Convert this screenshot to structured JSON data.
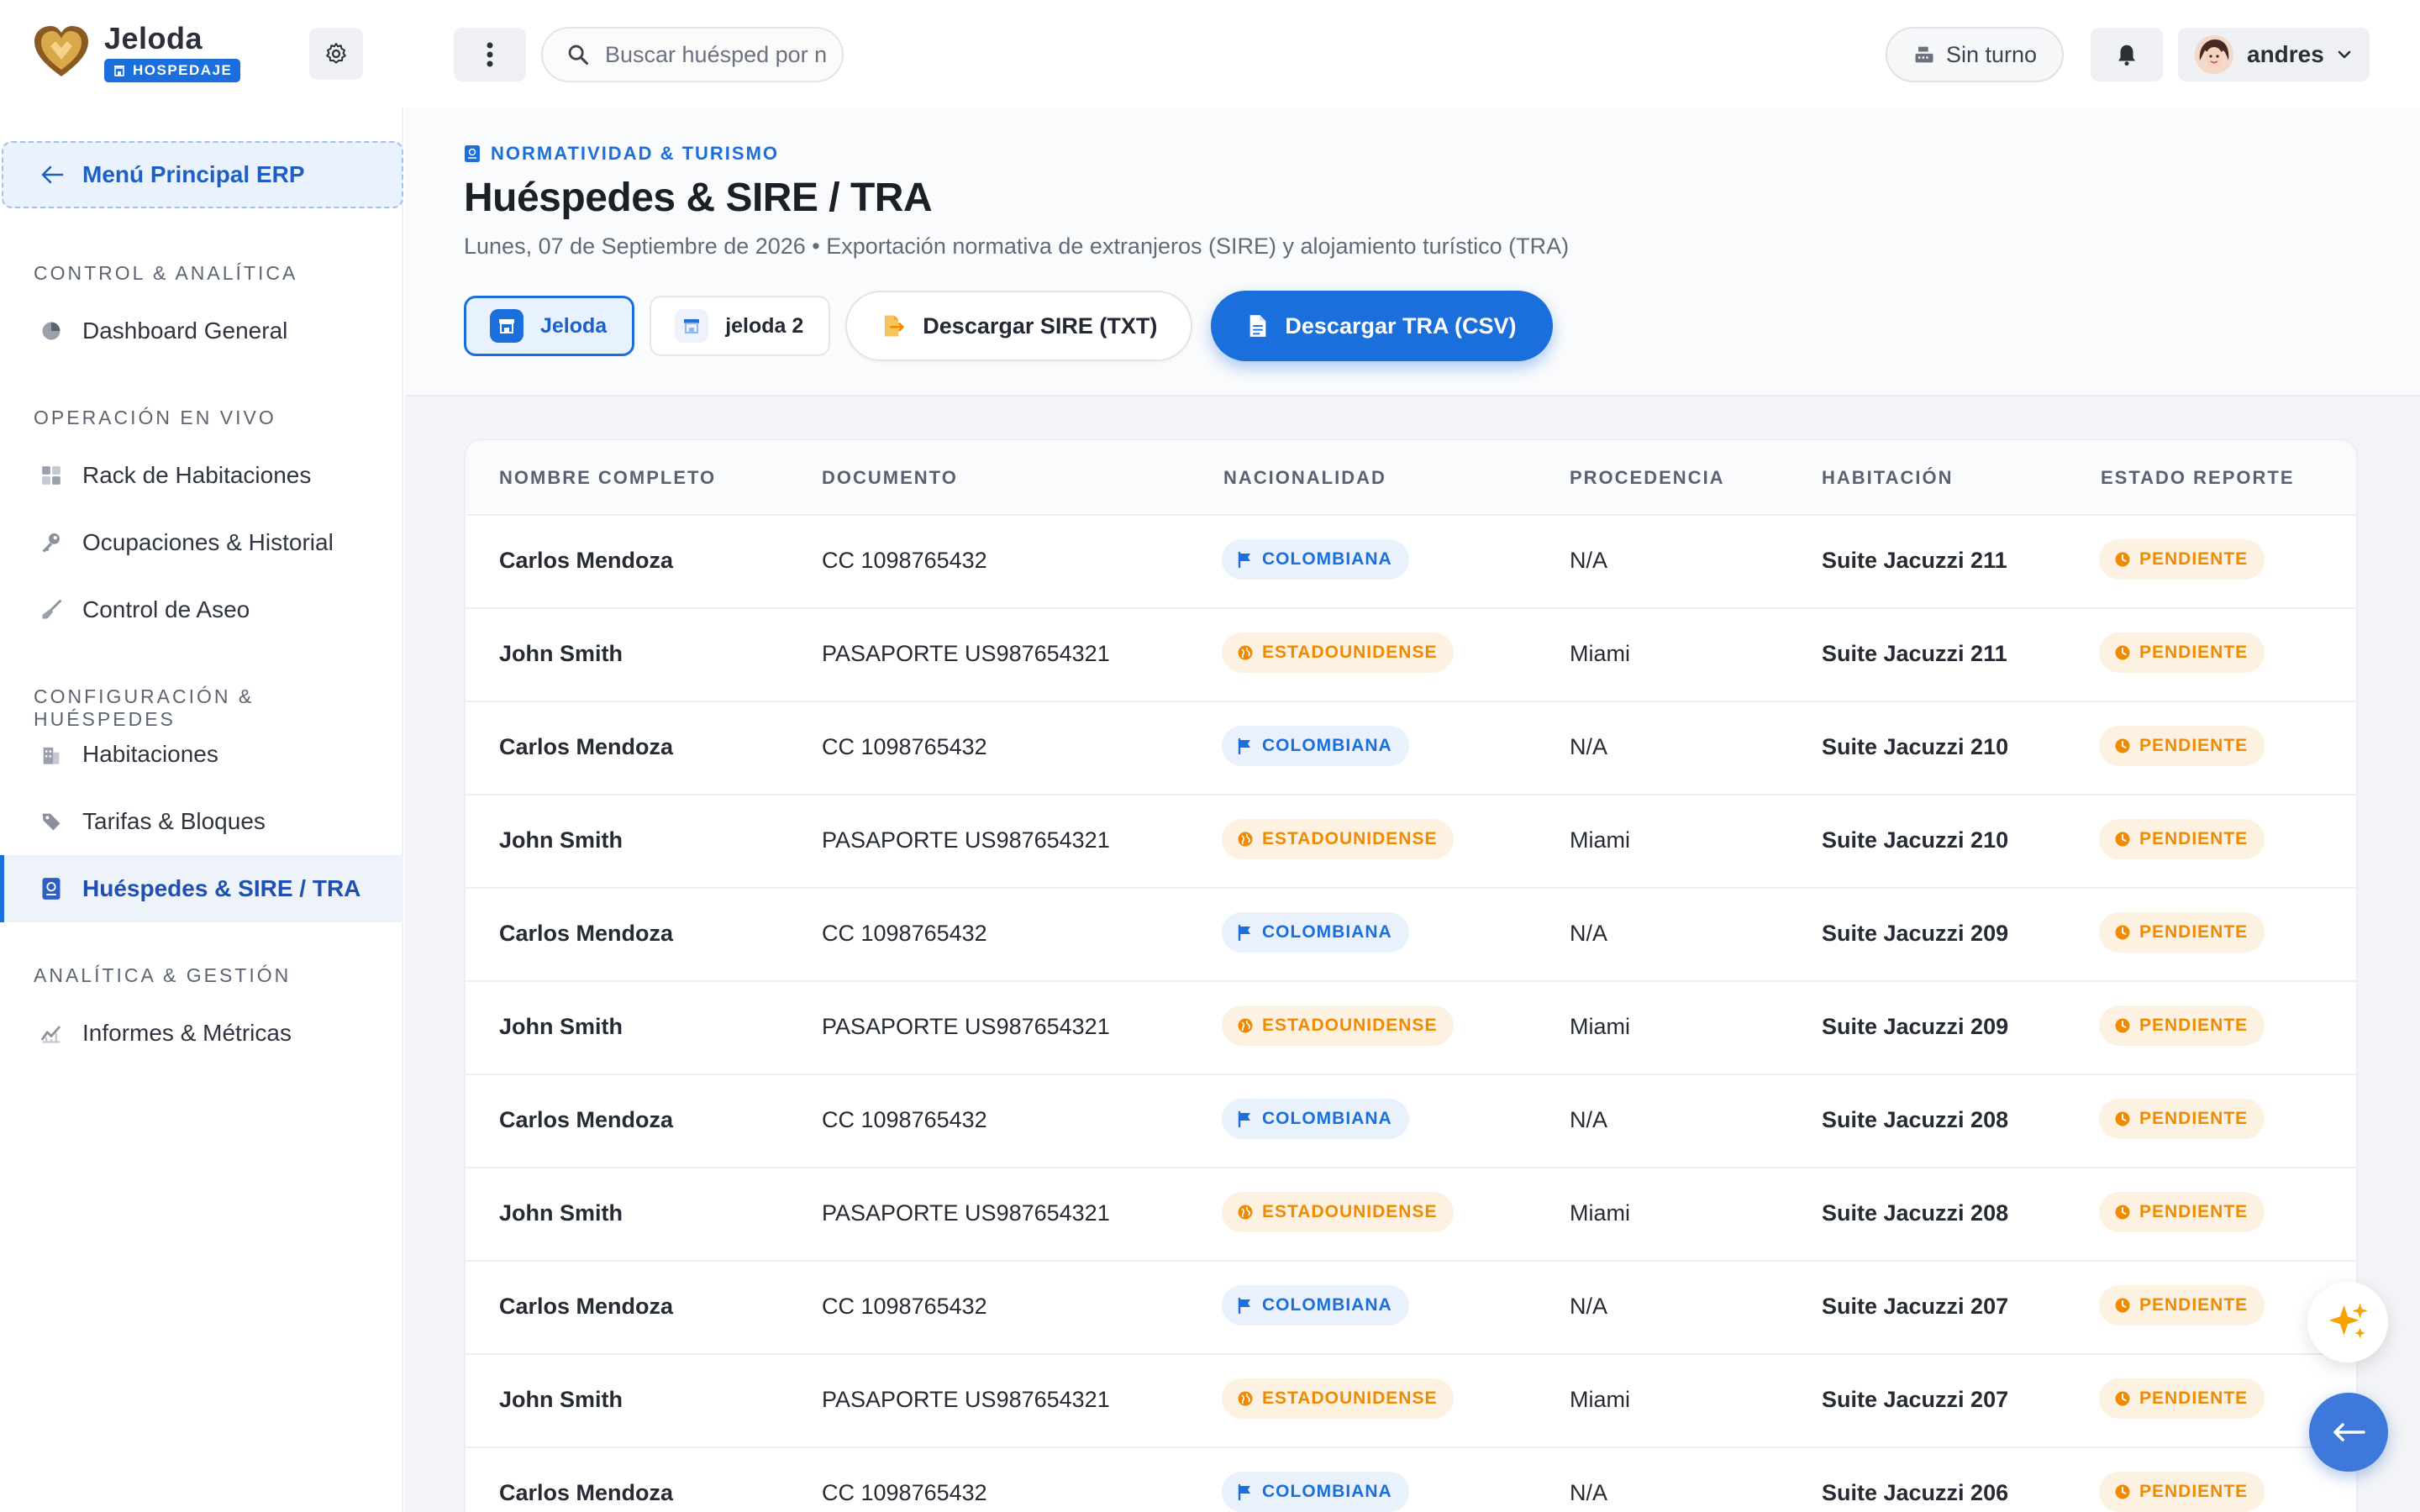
{
  "brand": {
    "name": "Jeloda",
    "badge": "HOSPEDAJE"
  },
  "topbar": {
    "search_placeholder": "Buscar huésped por n",
    "shift_label": "Sin turno",
    "user_name": "andres"
  },
  "sidebar": {
    "back_label": "Menú Principal ERP",
    "sections": [
      {
        "title": "CONTROL & ANALÍTICA",
        "items": [
          {
            "label": "Dashboard General",
            "icon": "pie-chart-icon"
          }
        ]
      },
      {
        "title": "OPERACIÓN EN VIVO",
        "items": [
          {
            "label": "Rack de Habitaciones",
            "icon": "grid-icon"
          },
          {
            "label": "Ocupaciones & Historial",
            "icon": "key-icon"
          },
          {
            "label": "Control de Aseo",
            "icon": "broom-icon"
          }
        ]
      },
      {
        "title": "CONFIGURACIÓN & HUÉSPEDES",
        "items": [
          {
            "label": "Habitaciones",
            "icon": "building-icon"
          },
          {
            "label": "Tarifas & Bloques",
            "icon": "tag-icon"
          },
          {
            "label": "Huéspedes & SIRE / TRA",
            "icon": "passport-icon",
            "active": true
          }
        ]
      },
      {
        "title": "ANALÍTICA & GESTIÓN",
        "items": [
          {
            "label": "Informes & Métricas",
            "icon": "line-chart-icon"
          }
        ]
      }
    ]
  },
  "header": {
    "overline": "NORMATIVIDAD & TURISMO",
    "title": "Huéspedes & SIRE / TRA",
    "subtitle": "Lunes, 07 de Septiembre de 2026 • Exportación normativa de extranjeros (SIRE) y alojamiento turístico (TRA)",
    "hotels": [
      {
        "label": "Jeloda",
        "selected": true
      },
      {
        "label": "jeloda 2",
        "selected": false
      }
    ],
    "download_sire": "Descargar SIRE (TXT)",
    "download_tra": "Descargar TRA (CSV)"
  },
  "table": {
    "columns": [
      "NOMBRE COMPLETO",
      "DOCUMENTO",
      "NACIONALIDAD",
      "PROCEDENCIA",
      "HABITACIÓN",
      "ESTADO REPORTE"
    ],
    "rows": [
      {
        "name": "Carlos Mendoza",
        "document": "CC 1098765432",
        "nationality": "COLOMBIANA",
        "origin": "N/A",
        "room": "Suite Jacuzzi 211",
        "status": "PENDIENTE"
      },
      {
        "name": "John Smith",
        "document": "PASAPORTE US987654321",
        "nationality": "ESTADOUNIDENSE",
        "origin": "Miami",
        "room": "Suite Jacuzzi 211",
        "status": "PENDIENTE"
      },
      {
        "name": "Carlos Mendoza",
        "document": "CC 1098765432",
        "nationality": "COLOMBIANA",
        "origin": "N/A",
        "room": "Suite Jacuzzi 210",
        "status": "PENDIENTE"
      },
      {
        "name": "John Smith",
        "document": "PASAPORTE US987654321",
        "nationality": "ESTADOUNIDENSE",
        "origin": "Miami",
        "room": "Suite Jacuzzi 210",
        "status": "PENDIENTE"
      },
      {
        "name": "Carlos Mendoza",
        "document": "CC 1098765432",
        "nationality": "COLOMBIANA",
        "origin": "N/A",
        "room": "Suite Jacuzzi 209",
        "status": "PENDIENTE"
      },
      {
        "name": "John Smith",
        "document": "PASAPORTE US987654321",
        "nationality": "ESTADOUNIDENSE",
        "origin": "Miami",
        "room": "Suite Jacuzzi 209",
        "status": "PENDIENTE"
      },
      {
        "name": "Carlos Mendoza",
        "document": "CC 1098765432",
        "nationality": "COLOMBIANA",
        "origin": "N/A",
        "room": "Suite Jacuzzi 208",
        "status": "PENDIENTE"
      },
      {
        "name": "John Smith",
        "document": "PASAPORTE US987654321",
        "nationality": "ESTADOUNIDENSE",
        "origin": "Miami",
        "room": "Suite Jacuzzi 208",
        "status": "PENDIENTE"
      },
      {
        "name": "Carlos Mendoza",
        "document": "CC 1098765432",
        "nationality": "COLOMBIANA",
        "origin": "N/A",
        "room": "Suite Jacuzzi 207",
        "status": "PENDIENTE"
      },
      {
        "name": "John Smith",
        "document": "PASAPORTE US987654321",
        "nationality": "ESTADOUNIDENSE",
        "origin": "Miami",
        "room": "Suite Jacuzzi 207",
        "status": "PENDIENTE"
      },
      {
        "name": "Carlos Mendoza",
        "document": "CC 1098765432",
        "nationality": "COLOMBIANA",
        "origin": "N/A",
        "room": "Suite Jacuzzi 206",
        "status": "PENDIENTE"
      }
    ]
  },
  "colors": {
    "accent": "#1a6fdc",
    "warning": "#f08a00",
    "sidebar_active_bg": "#eef2f9"
  }
}
